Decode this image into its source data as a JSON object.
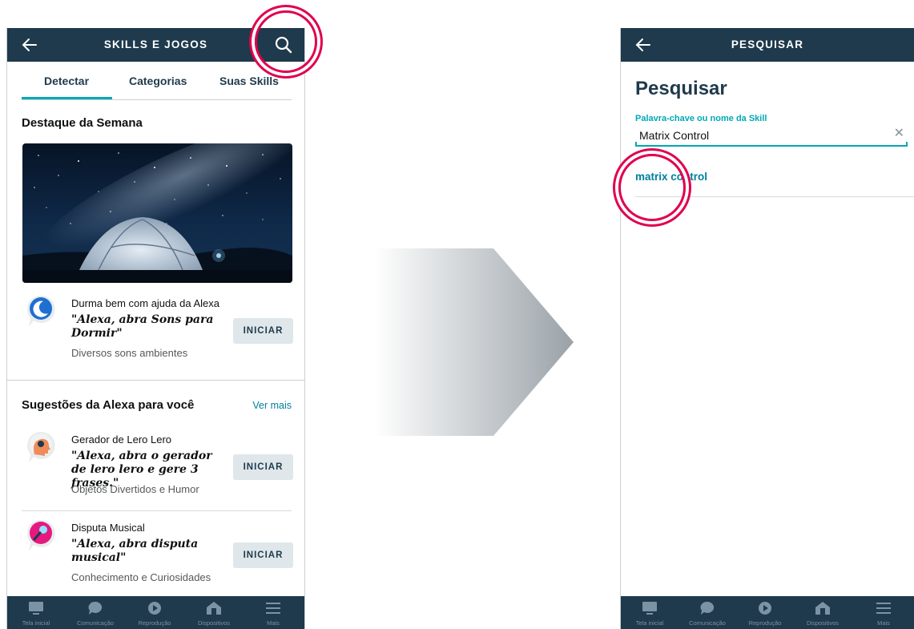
{
  "left_screen": {
    "header": {
      "title": "SKILLS E JOGOS",
      "back_icon": "arrow-left-icon",
      "search_icon": "search-icon"
    },
    "tabs": [
      {
        "label": "Detectar",
        "active": true
      },
      {
        "label": "Categorias",
        "active": false
      },
      {
        "label": "Suas Skills",
        "active": false
      }
    ],
    "featured": {
      "title": "Destaque da Semana",
      "image": "night-sky-tent-image",
      "skill": {
        "name": "Durma bem com ajuda da Alexa",
        "phrase": "\"Alexa, abra Sons para Dormir\"",
        "category": "Diversos sons ambientes",
        "button": "INICIAR",
        "icon": "moon-bubble-icon"
      }
    },
    "suggestions": {
      "title": "Sugestões da Alexa para você",
      "see_more": "Ver mais",
      "items": [
        {
          "name": "Gerador de Lero Lero",
          "phrase": "\"Alexa, abra o gerador de lero lero e gere 3 frases.\"",
          "category": "Objetos Divertidos e Humor",
          "button": "INICIAR",
          "icon": "head-bubble-icon"
        },
        {
          "name": "Disputa Musical",
          "phrase": "\"Alexa, abra disputa musical\"",
          "category": "Conhecimento e Curiosidades",
          "button": "INICIAR",
          "icon": "microphone-bubble-icon"
        }
      ]
    }
  },
  "right_screen": {
    "header": {
      "title": "PESQUISAR",
      "back_icon": "arrow-left-icon"
    },
    "heading": "Pesquisar",
    "search_field": {
      "label": "Palavra-chave ou nome da Skill",
      "value": "Matrix Control",
      "clear_icon": "close-icon"
    },
    "suggestion": "matrix control"
  },
  "bottom_nav": [
    {
      "label": "Tela inicial",
      "icon": "home-screen-icon"
    },
    {
      "label": "Comunicação",
      "icon": "chat-bubble-icon"
    },
    {
      "label": "Reprodução",
      "icon": "play-icon"
    },
    {
      "label": "Dispositivos",
      "icon": "devices-house-icon"
    },
    {
      "label": "Mais",
      "icon": "menu-icon"
    }
  ],
  "colors": {
    "header": "#1e3a4c",
    "accent": "#00a8b5",
    "link": "#00809d",
    "highlight_ring": "#e0004d",
    "button_bg": "#dfe7ea"
  }
}
